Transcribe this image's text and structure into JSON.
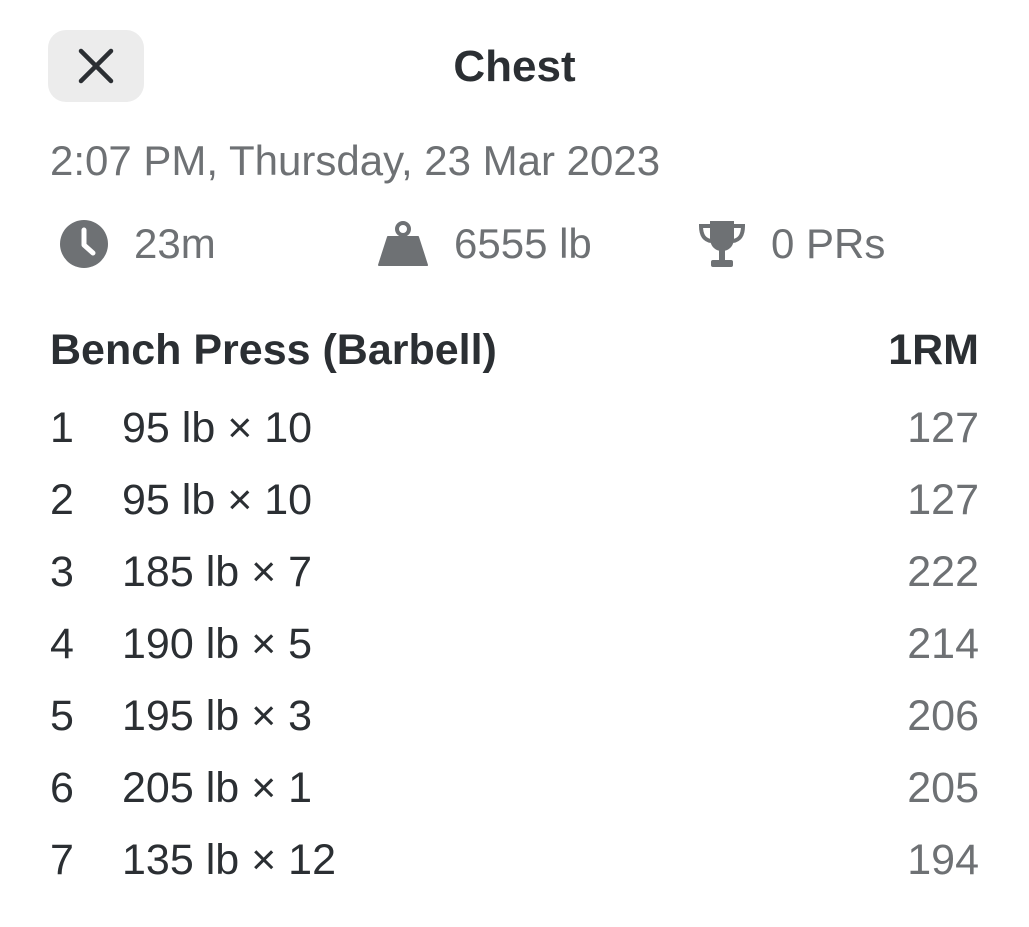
{
  "header": {
    "title": "Chest",
    "close_icon": "close-icon"
  },
  "workout": {
    "date": "2:07 PM, Thursday, 23 Mar 2023",
    "stats": {
      "duration": {
        "icon": "clock-icon",
        "value": "23m"
      },
      "volume": {
        "icon": "weight-icon",
        "value": "6555 lb"
      },
      "prs": {
        "icon": "trophy-icon",
        "value": "0 PRs"
      }
    }
  },
  "exercise": {
    "name": "Bench Press (Barbell)",
    "column_header": "1RM",
    "sets": [
      {
        "num": "1",
        "detail": "95 lb × 10",
        "one_rm": "127"
      },
      {
        "num": "2",
        "detail": "95 lb × 10",
        "one_rm": "127"
      },
      {
        "num": "3",
        "detail": "185 lb × 7",
        "one_rm": "222"
      },
      {
        "num": "4",
        "detail": "190 lb × 5",
        "one_rm": "214"
      },
      {
        "num": "5",
        "detail": "195 lb × 3",
        "one_rm": "206"
      },
      {
        "num": "6",
        "detail": "205 lb × 1",
        "one_rm": "205"
      },
      {
        "num": "7",
        "detail": "135 lb × 12",
        "one_rm": "194"
      }
    ]
  },
  "colors": {
    "primary_text": "#2b2f33",
    "secondary_text": "#6e7174",
    "close_button_bg": "#ececec"
  }
}
